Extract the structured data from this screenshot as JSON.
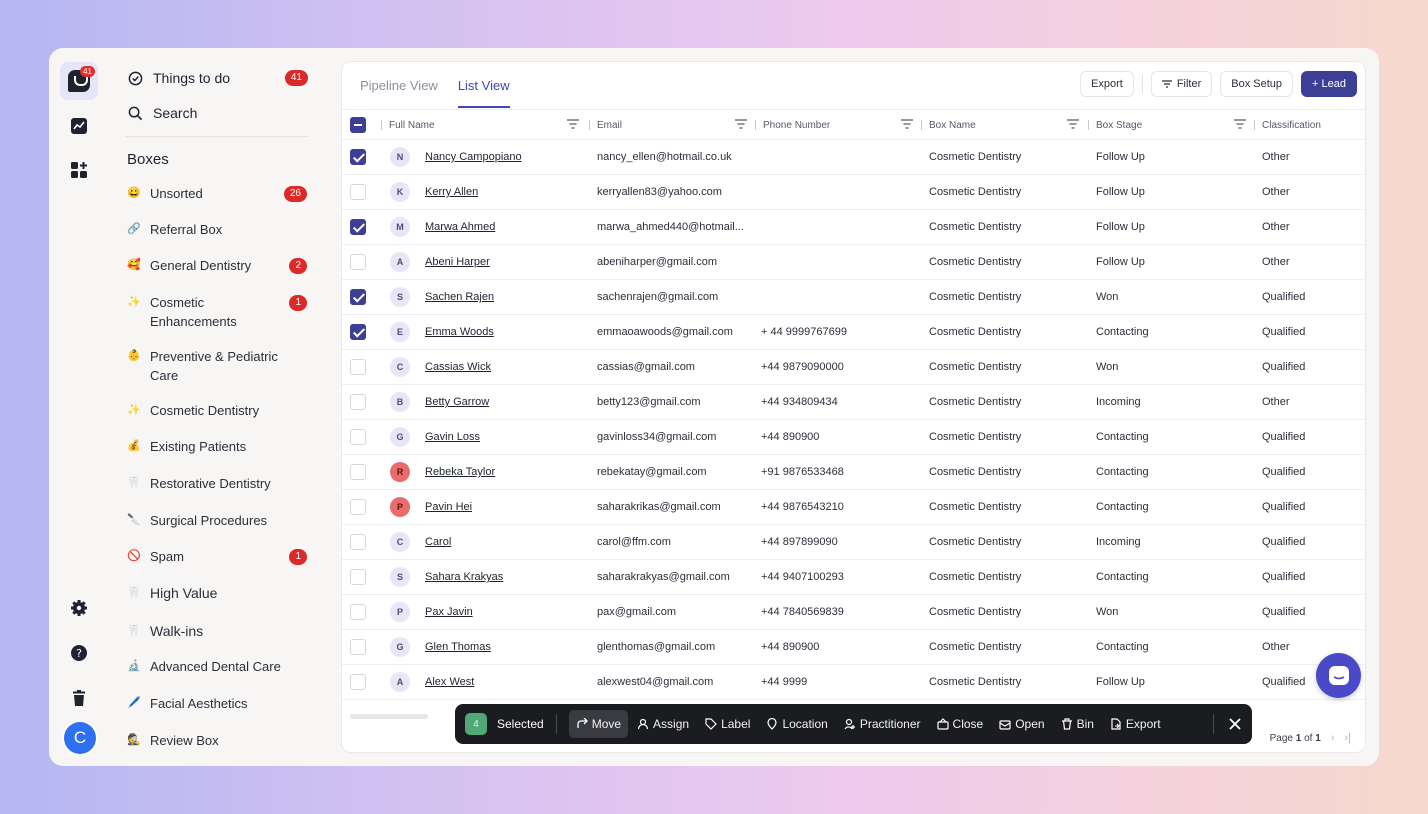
{
  "rail": {
    "logo_badge": "41",
    "avatar_letter": "C"
  },
  "sidebar": {
    "things_to_do": {
      "label": "Things to do",
      "count": "41"
    },
    "search": {
      "label": "Search"
    },
    "boxes_title": "Boxes",
    "boxes": [
      {
        "emoji": "😀",
        "label": "Unsorted",
        "count": "26"
      },
      {
        "emoji": "🔗",
        "label": "Referral Box",
        "count": ""
      },
      {
        "emoji": "🥰",
        "label": "General Dentistry",
        "count": "2"
      },
      {
        "emoji": "✨",
        "label": "Cosmetic Enhancements",
        "count": "1"
      },
      {
        "emoji": "👶",
        "label": "Preventive & Pediatric Care",
        "count": ""
      },
      {
        "emoji": "✨",
        "label": "Cosmetic Dentistry",
        "count": ""
      },
      {
        "emoji": "💰",
        "label": "Existing Patients",
        "count": ""
      },
      {
        "emoji": "🦷",
        "label": "Restorative Dentistry",
        "count": ""
      },
      {
        "emoji": "🔪",
        "label": "Surgical Procedures",
        "count": ""
      },
      {
        "emoji": "🚫",
        "label": "Spam",
        "count": "1"
      },
      {
        "emoji": "🦷",
        "label": "High Value",
        "count": ""
      },
      {
        "emoji": "🦷",
        "label": "Walk-ins",
        "count": ""
      },
      {
        "emoji": "🔬",
        "label": "Advanced Dental Care",
        "count": ""
      },
      {
        "emoji": "🖊️",
        "label": "Facial Aesthetics",
        "count": ""
      },
      {
        "emoji": "🕵",
        "label": "Review Box",
        "count": ""
      }
    ]
  },
  "tabs": [
    "Pipeline View",
    "List View"
  ],
  "toolbar": {
    "export": "Export",
    "filter": "Filter",
    "box_setup": "Box Setup",
    "add_lead": "+ Lead"
  },
  "table": {
    "columns": [
      "Full Name",
      "Email",
      "Phone Number",
      "Box Name",
      "Box Stage",
      "Classification"
    ],
    "rows": [
      {
        "checked": true,
        "initial": "N",
        "red": false,
        "name": "Nancy Campopiano",
        "email": "nancy_ellen@hotmail.co.uk",
        "phone": "",
        "box": "Cosmetic Dentistry",
        "stage": "Follow Up",
        "class": "Other"
      },
      {
        "checked": false,
        "initial": "K",
        "red": false,
        "name": "Kerry Allen",
        "email": "kerryallen83@yahoo.com",
        "phone": "",
        "box": "Cosmetic Dentistry",
        "stage": "Follow Up",
        "class": "Other"
      },
      {
        "checked": true,
        "initial": "M",
        "red": false,
        "name": "Marwa Ahmed",
        "email": "marwa_ahmed440@hotmail...",
        "phone": "",
        "box": "Cosmetic Dentistry",
        "stage": "Follow Up",
        "class": "Other"
      },
      {
        "checked": false,
        "initial": "A",
        "red": false,
        "name": "Abeni Harper",
        "email": "abeniharper@gmail.com",
        "phone": "",
        "box": "Cosmetic Dentistry",
        "stage": "Follow Up",
        "class": "Other"
      },
      {
        "checked": true,
        "initial": "S",
        "red": false,
        "name": "Sachen Rajen",
        "email": "sachenrajen@gmail.com",
        "phone": "",
        "box": "Cosmetic Dentistry",
        "stage": "Won",
        "class": "Qualified"
      },
      {
        "checked": true,
        "initial": "E",
        "red": false,
        "name": "Emma Woods",
        "email": "emmaoawoods@gmail.com",
        "phone": "+ 44 9999767699",
        "box": "Cosmetic Dentistry",
        "stage": "Contacting",
        "class": "Qualified"
      },
      {
        "checked": false,
        "initial": "C",
        "red": false,
        "name": "Cassias Wick",
        "email": "cassias@gmail.com",
        "phone": "+44 9879090000",
        "box": "Cosmetic Dentistry",
        "stage": "Won",
        "class": "Qualified"
      },
      {
        "checked": false,
        "initial": "B",
        "red": false,
        "name": "Betty Garrow",
        "email": "betty123@gmail.com",
        "phone": "+44 934809434",
        "box": "Cosmetic Dentistry",
        "stage": "Incoming",
        "class": "Other"
      },
      {
        "checked": false,
        "initial": "G",
        "red": false,
        "name": "Gavin Loss",
        "email": "gavinloss34@gmail.com",
        "phone": "+44 890900",
        "box": "Cosmetic Dentistry",
        "stage": "Contacting",
        "class": "Qualified"
      },
      {
        "checked": false,
        "initial": "R",
        "red": true,
        "name": "Rebeka Taylor",
        "email": "rebekatay@gmail.com",
        "phone": "+91 9876533468",
        "box": "Cosmetic Dentistry",
        "stage": "Contacting",
        "class": "Qualified"
      },
      {
        "checked": false,
        "initial": "P",
        "red": true,
        "name": "Pavin Hei",
        "email": "saharakrikas@gmail.com",
        "phone": "+44 9876543210",
        "box": "Cosmetic Dentistry",
        "stage": "Contacting",
        "class": "Qualified"
      },
      {
        "checked": false,
        "initial": "C",
        "red": false,
        "name": "Carol",
        "email": "carol@ffm.com",
        "phone": "+44 897899090",
        "box": "Cosmetic Dentistry",
        "stage": "Incoming",
        "class": "Qualified"
      },
      {
        "checked": false,
        "initial": "S",
        "red": false,
        "name": "Sahara Krakyas",
        "email": "saharakrakyas@gmail.com",
        "phone": "+44 9407100293",
        "box": "Cosmetic Dentistry",
        "stage": "Contacting",
        "class": "Qualified"
      },
      {
        "checked": false,
        "initial": "P",
        "red": false,
        "name": "Pax Javin",
        "email": "pax@gmail.com",
        "phone": "+44 7840569839",
        "box": "Cosmetic Dentistry",
        "stage": "Won",
        "class": "Qualified"
      },
      {
        "checked": false,
        "initial": "G",
        "red": false,
        "name": "Glen Thomas",
        "email": "glenthomas@gmail.com",
        "phone": "+44 890900",
        "box": "Cosmetic Dentistry",
        "stage": "Contacting",
        "class": "Other"
      },
      {
        "checked": false,
        "initial": "A",
        "red": false,
        "name": "Alex West",
        "email": "alexwest04@gmail.com",
        "phone": "+44 9999",
        "box": "Cosmetic Dentistry",
        "stage": "Follow Up",
        "class": "Qualified"
      }
    ]
  },
  "bulk": {
    "count": "4",
    "selected": "Selected",
    "actions": [
      "Move",
      "Assign",
      "Label",
      "Location",
      "Practitioner",
      "Close",
      "Open",
      "Bin",
      "Export"
    ]
  },
  "pager": {
    "prefix": "Page",
    "current": "1",
    "of": "of",
    "total": "1"
  }
}
